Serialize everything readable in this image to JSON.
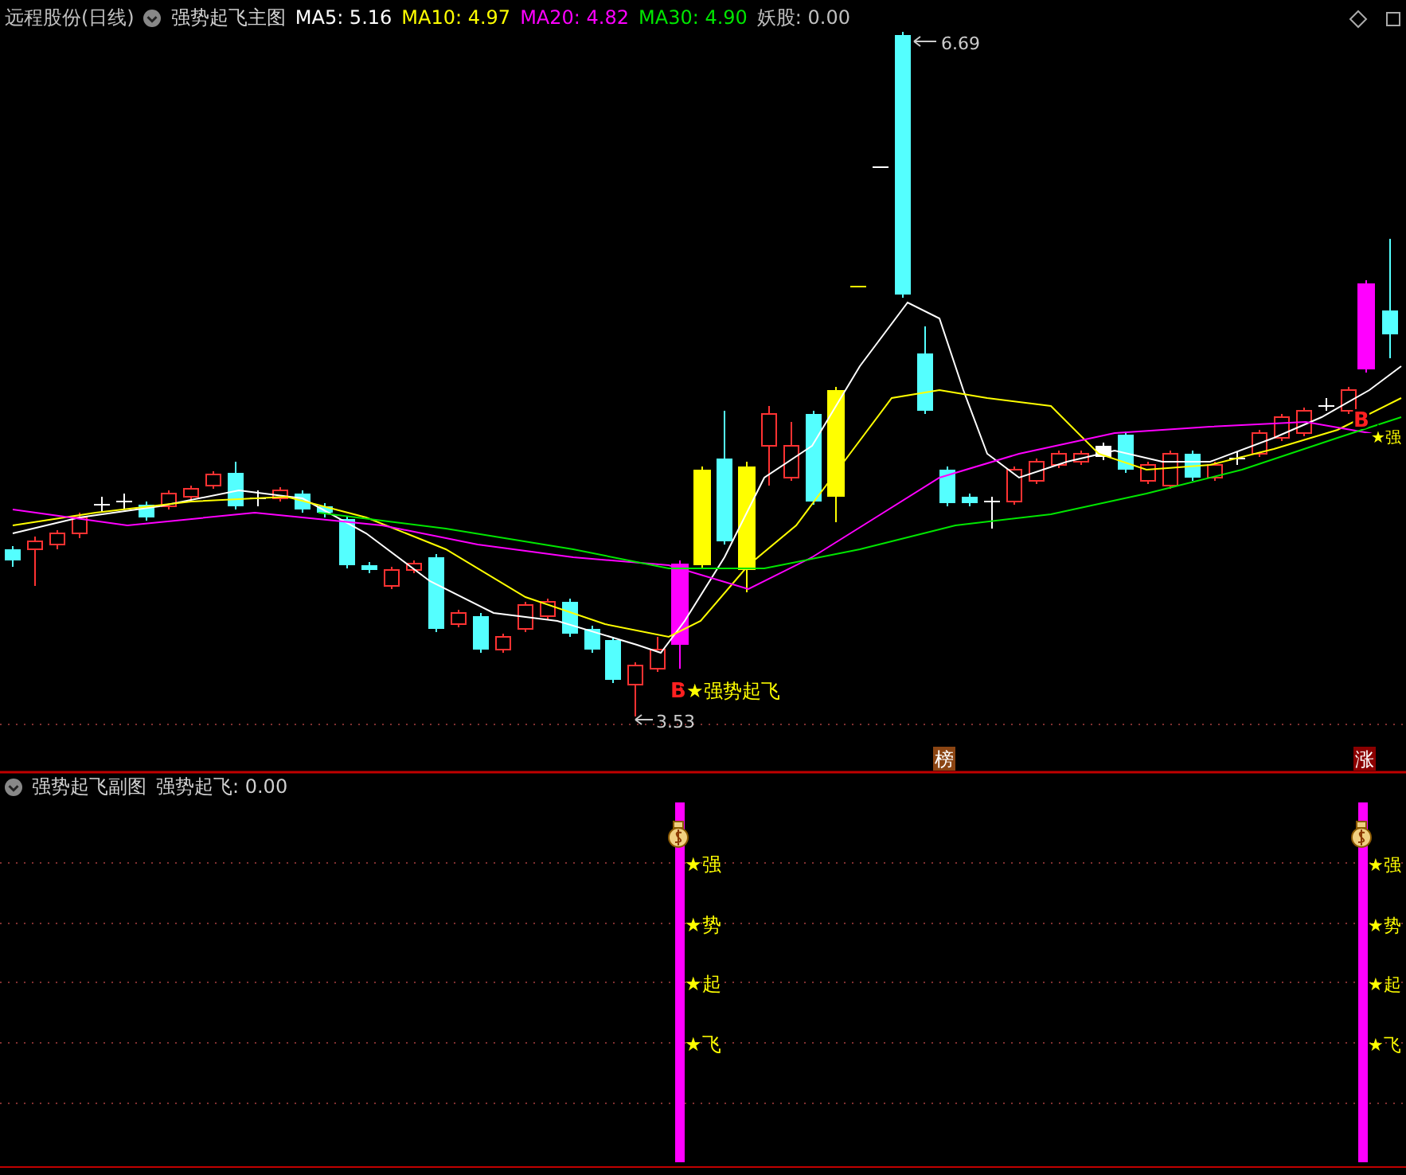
{
  "header": {
    "title": "远程股份(日线)",
    "indicator": "强势起飞主图",
    "values": [
      {
        "label": "MA5:",
        "value": "5.16",
        "color": "#ffffff"
      },
      {
        "label": "MA10:",
        "value": "4.97",
        "color": "#ffff00"
      },
      {
        "label": "MA20:",
        "value": "4.82",
        "color": "#ff00ff"
      },
      {
        "label": "MA30:",
        "value": "4.90",
        "color": "#00e600"
      },
      {
        "label": "妖股:",
        "value": "0.00",
        "color": "#c0c0c0"
      }
    ]
  },
  "main_chart": {
    "high_label": "6.69",
    "low_label": "3.53",
    "signals": [
      {
        "letter": "B",
        "text": "★强势起飞"
      },
      {
        "letter": "B",
        "text": "★强"
      }
    ],
    "markers": [
      {
        "text": "榜",
        "color": "#8b4513"
      },
      {
        "text": "涨",
        "color": "#8b0000"
      }
    ]
  },
  "sub_chart": {
    "title": "强势起飞副图",
    "value_label": "强势起飞:",
    "value": "0.00",
    "columns": [
      {
        "labels": [
          "★强",
          "★势",
          "★起",
          "★飞"
        ]
      },
      {
        "labels": [
          "★强",
          "★势",
          "★起",
          "★飞"
        ]
      }
    ]
  }
}
